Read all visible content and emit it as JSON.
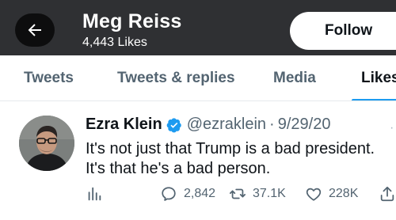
{
  "header": {
    "back_icon": "arrow-left-icon",
    "profile_name": "Meg Reiss",
    "likes_count": "4,443 Likes",
    "follow_label": "Follow"
  },
  "tabs": [
    {
      "label": "Tweets",
      "active": false
    },
    {
      "label": "Tweets & replies",
      "active": false
    },
    {
      "label": "Media",
      "active": false
    },
    {
      "label": "Likes",
      "active": true
    }
  ],
  "tweet": {
    "author_name": "Ezra Klein",
    "verified": true,
    "handle": "@ezraklein",
    "separator": "·",
    "date": "9/29/20",
    "text_line1": "It's not just that Trump is a bad president.",
    "text_line2": "It's that he's a bad person.",
    "actions": {
      "analytics_icon": "analytics-icon",
      "reply_count": "2,842",
      "retweet_count": "37.1K",
      "like_count": "228K",
      "share_icon": "share-icon"
    }
  },
  "colors": {
    "header_bg": "#2f3033",
    "accent": "#1d9bf0",
    "muted_text": "#536471",
    "primary_text": "#0f1419"
  }
}
